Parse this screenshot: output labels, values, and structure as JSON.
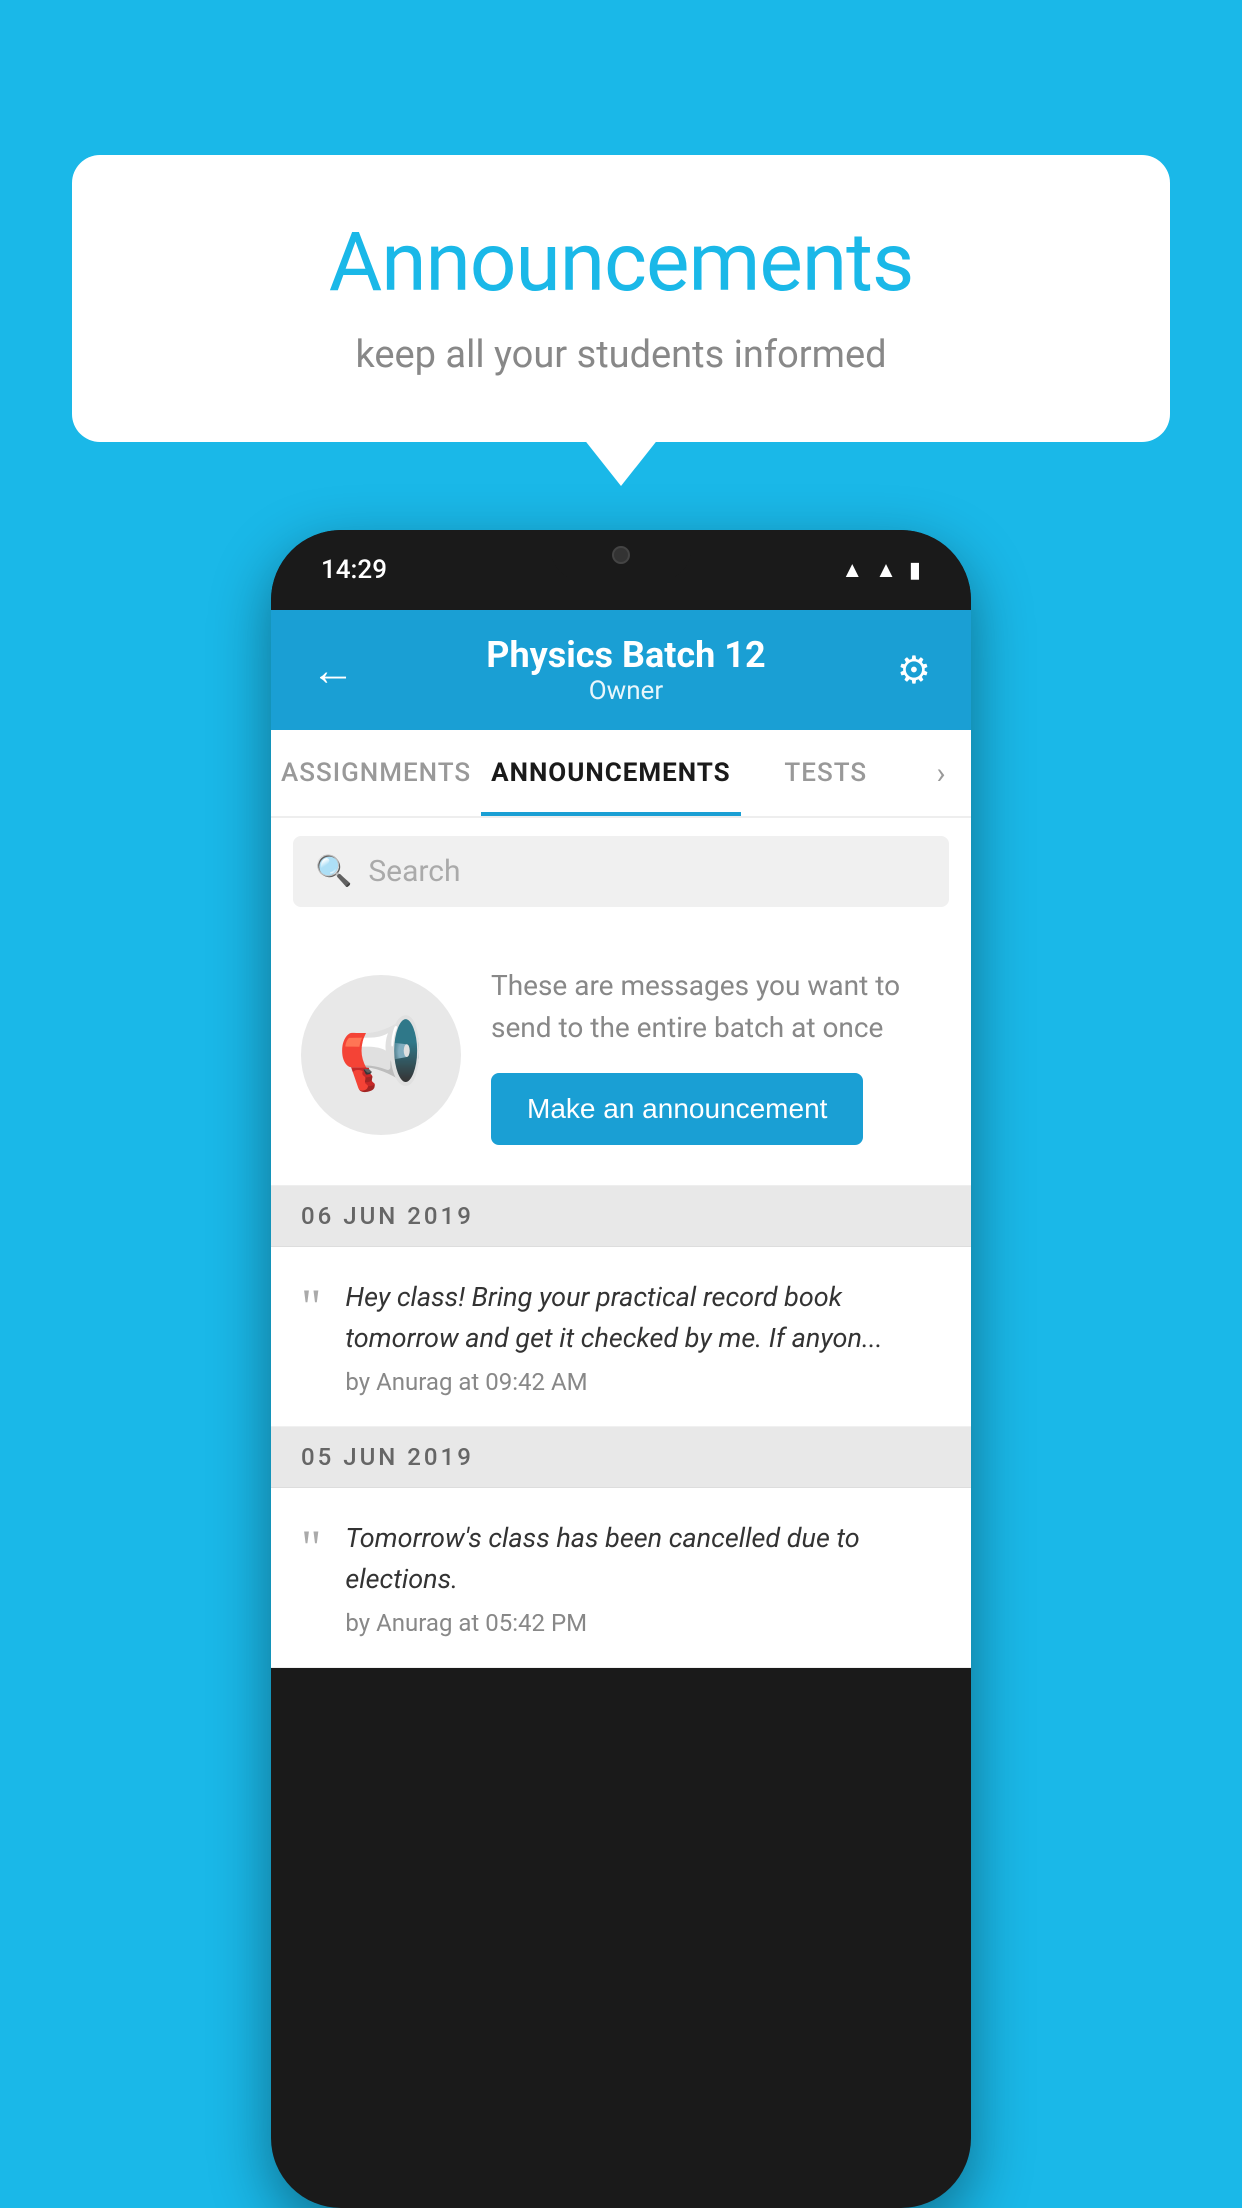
{
  "background_color": "#1ab8e8",
  "speech_bubble": {
    "title": "Announcements",
    "subtitle": "keep all your students informed"
  },
  "phone": {
    "status_bar": {
      "time": "14:29",
      "icons": [
        "wifi",
        "signal",
        "battery"
      ]
    },
    "app_bar": {
      "title": "Physics Batch 12",
      "subtitle": "Owner",
      "back_label": "←",
      "settings_label": "⚙"
    },
    "tabs": [
      {
        "label": "ASSIGNMENTS",
        "active": false
      },
      {
        "label": "ANNOUNCEMENTS",
        "active": true
      },
      {
        "label": "TESTS",
        "active": false
      }
    ],
    "search": {
      "placeholder": "Search"
    },
    "promo": {
      "description": "These are messages you want to send to the entire batch at once",
      "button_label": "Make an announcement"
    },
    "announcements": [
      {
        "date": "06  JUN  2019",
        "text": "Hey class! Bring your practical record book tomorrow and get it checked by me. If anyon...",
        "meta": "by Anurag at 09:42 AM"
      },
      {
        "date": "05  JUN  2019",
        "text": "Tomorrow's class has been cancelled due to elections.",
        "meta": "by Anurag at 05:42 PM"
      }
    ]
  }
}
